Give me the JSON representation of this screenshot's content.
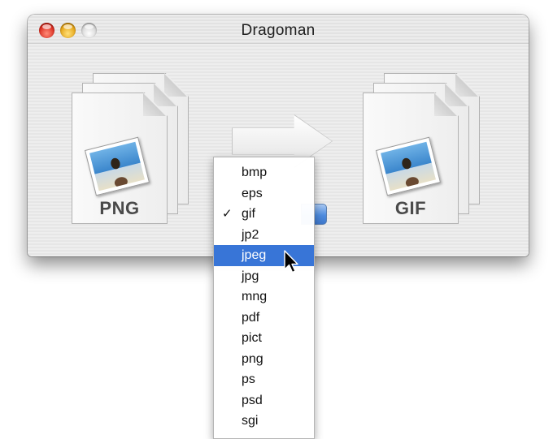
{
  "window": {
    "title": "Dragoman"
  },
  "source": {
    "format_label": "PNG",
    "icon": "png-file-stack-icon"
  },
  "target": {
    "format_label": "GIF",
    "icon": "gif-file-stack-icon"
  },
  "converter": {
    "icon": "arrow-right-icon"
  },
  "menu": {
    "checked": "gif",
    "highlighted": "jpeg",
    "items": [
      {
        "label": "bmp"
      },
      {
        "label": "eps"
      },
      {
        "label": "gif",
        "checked": true
      },
      {
        "label": "jp2"
      },
      {
        "label": "jpeg",
        "highlighted": true
      },
      {
        "label": "jpg"
      },
      {
        "label": "mng"
      },
      {
        "label": "pdf"
      },
      {
        "label": "pict"
      },
      {
        "label": "png"
      },
      {
        "label": "ps"
      },
      {
        "label": "psd"
      },
      {
        "label": "sgi"
      }
    ],
    "checkmark": "✓"
  },
  "colors": {
    "menu_highlight": "#3875d7",
    "close": "#d8261a",
    "minimize": "#e3a00e",
    "zoom": "#d2d2d2"
  }
}
